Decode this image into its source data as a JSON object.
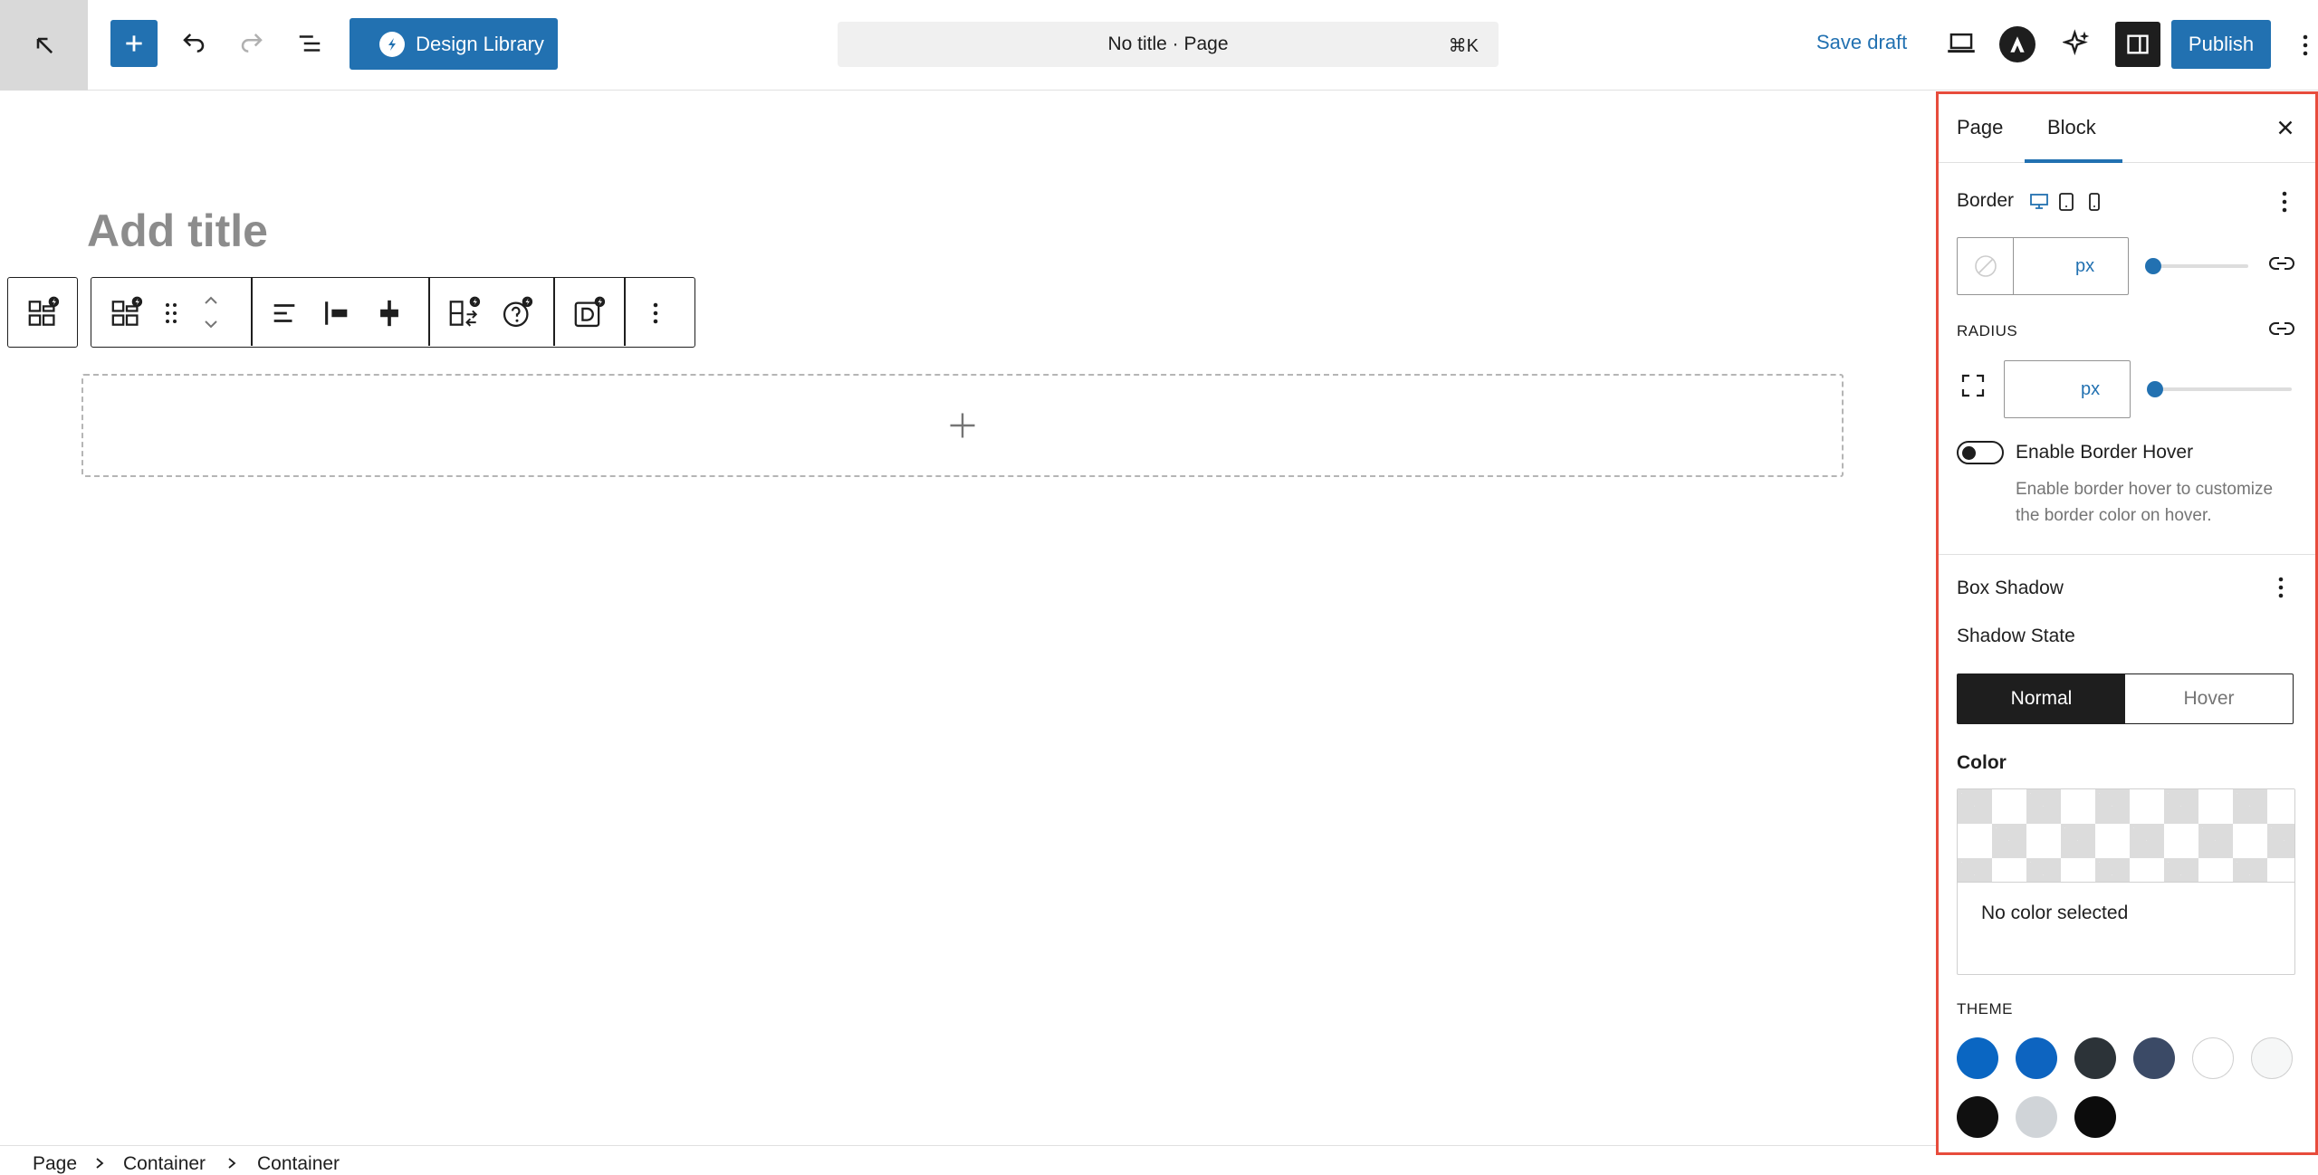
{
  "topbar": {
    "design_library_label": "Design Library",
    "doc_title": "No title · Page",
    "shortcut": "⌘K",
    "save_draft": "Save draft",
    "publish": "Publish"
  },
  "editor": {
    "title_placeholder": "Add title"
  },
  "breadcrumb": [
    "Page",
    "Container",
    "Container"
  ],
  "sidebar": {
    "tabs": [
      "Page",
      "Block"
    ],
    "active_tab": "Block",
    "border": {
      "label": "Border",
      "unit": "px",
      "slider_value": 0
    },
    "radius": {
      "label": "RADIUS",
      "unit": "px",
      "slider_value": 0
    },
    "border_hover": {
      "label": "Enable Border Hover",
      "help_line1": "Enable border hover to customize",
      "help_line2": "the border color on hover.",
      "enabled": false
    },
    "box_shadow": {
      "label": "Box Shadow",
      "state_label": "Shadow State",
      "states": [
        "Normal",
        "Hover"
      ],
      "active_state": "Normal"
    },
    "color": {
      "label": "Color",
      "placeholder": "No color selected",
      "theme_label": "THEME",
      "theme_colors": [
        "#0a66c2",
        "#0d64c0",
        "#2c3338",
        "#3b4a66",
        "#ffffff",
        "#f6f7f7",
        "#101010",
        "#d0d4d8",
        "#0c0c0c"
      ]
    }
  },
  "colors": {
    "accent": "#2271b1",
    "highlight_border": "#e74c3c"
  }
}
